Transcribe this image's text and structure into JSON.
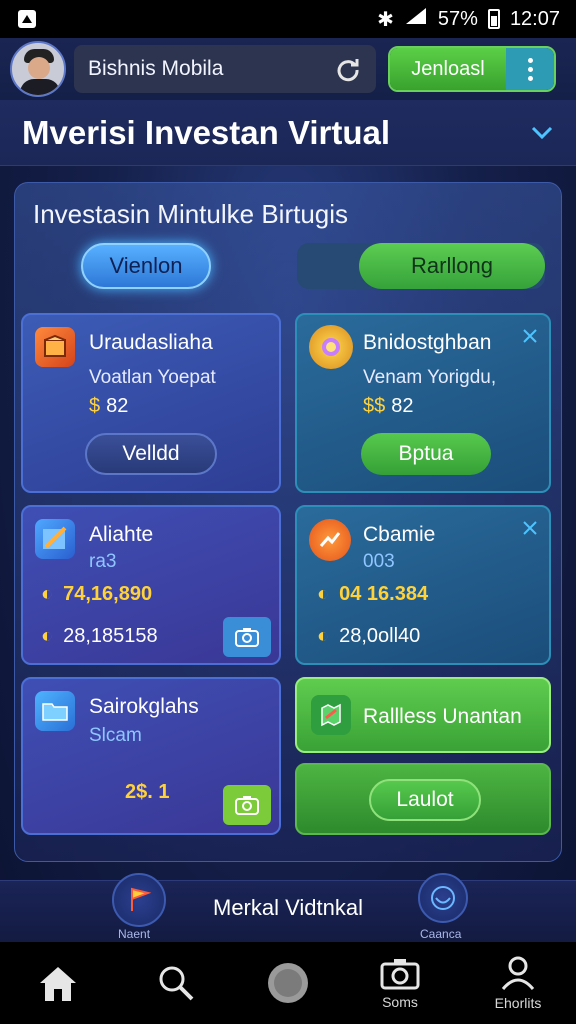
{
  "status_bar": {
    "battery": "57%",
    "time": "12:07"
  },
  "header": {
    "app_name": "Bishnis Mobila",
    "download_label": "Jenloasl"
  },
  "title": "Mverisi Investan Virtual",
  "panel": {
    "title": "Investasin Mintulke Birtugis",
    "tabs": [
      {
        "label": "Vienlon"
      },
      {
        "label": "Rarllong"
      }
    ]
  },
  "cards": [
    {
      "title": "Uraudasliaha",
      "subtitle": "Voatlan Yoepat",
      "currency": "$",
      "price": "82",
      "button": "Velldd"
    },
    {
      "title": "Bnidostghban",
      "subtitle": "Venam Yorigdu,",
      "currency": "$$",
      "price": "82",
      "button": "Bptua"
    },
    {
      "title": "Aliahte",
      "subtitle": "ra3",
      "stat1": "74,16,890",
      "stat2": "28,185158"
    },
    {
      "title": "Cbamie",
      "subtitle": "003",
      "stat1": "04 16.384",
      "stat2": "28,0oll40"
    },
    {
      "title": "Sairokglahs",
      "subtitle": "Slcam",
      "price": "2$. 1"
    }
  ],
  "actions": {
    "primary": "Rallless Unantan",
    "secondary": "Laulot"
  },
  "bottom_strip": {
    "left_label": "Naent",
    "center": "Merkal Vidtnkal",
    "right_label": "Caanca"
  },
  "nav": {
    "items": [
      {
        "label": ""
      },
      {
        "label": ""
      },
      {
        "label": ""
      },
      {
        "label": "Soms"
      },
      {
        "label": "Ehorlits"
      }
    ]
  },
  "colors": {
    "accent_green": "#4fc241",
    "accent_blue": "#3f8fe8",
    "yellow": "#ffd23b"
  }
}
